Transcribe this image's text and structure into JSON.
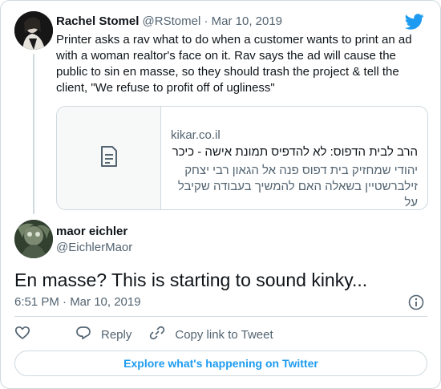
{
  "parent_tweet": {
    "name": "Rachel Stomel",
    "handle": "@RStomel",
    "separator": "·",
    "date": "Mar 10, 2019",
    "text": "Printer asks a rav what to do when a customer wants to print an ad with a woman realtor's face on it. Rav says the ad will cause the public to sin en masse, so they should trash the project & tell the client, \"We refuse to profit off of ugliness\"",
    "link_card": {
      "domain": "kikar.co.il",
      "title": "הרב לבית הדפוס: לא להדפיס תמונת אישה - כיכר ...",
      "description": "יהודי שמחזיק בית דפוס פנה אל הגאון רבי יצחק זילברשטיין בשאלה האם להמשיך בעבודה שקיבל על",
      "thumb_icon": "document-icon"
    }
  },
  "main_tweet": {
    "name": "maor eichler",
    "handle": "@EichlerMaor",
    "text": "En masse? This is starting to sound kinky...",
    "timestamp": "6:51 PM · Mar 10, 2019"
  },
  "actions": {
    "reply_label": "Reply",
    "copy_link_label": "Copy link to Tweet"
  },
  "explore_label": "Explore what's happening on Twitter",
  "colors": {
    "accent": "#1d9bf0",
    "text": "#0f1419",
    "muted": "#536471",
    "border": "#cfd9de"
  }
}
